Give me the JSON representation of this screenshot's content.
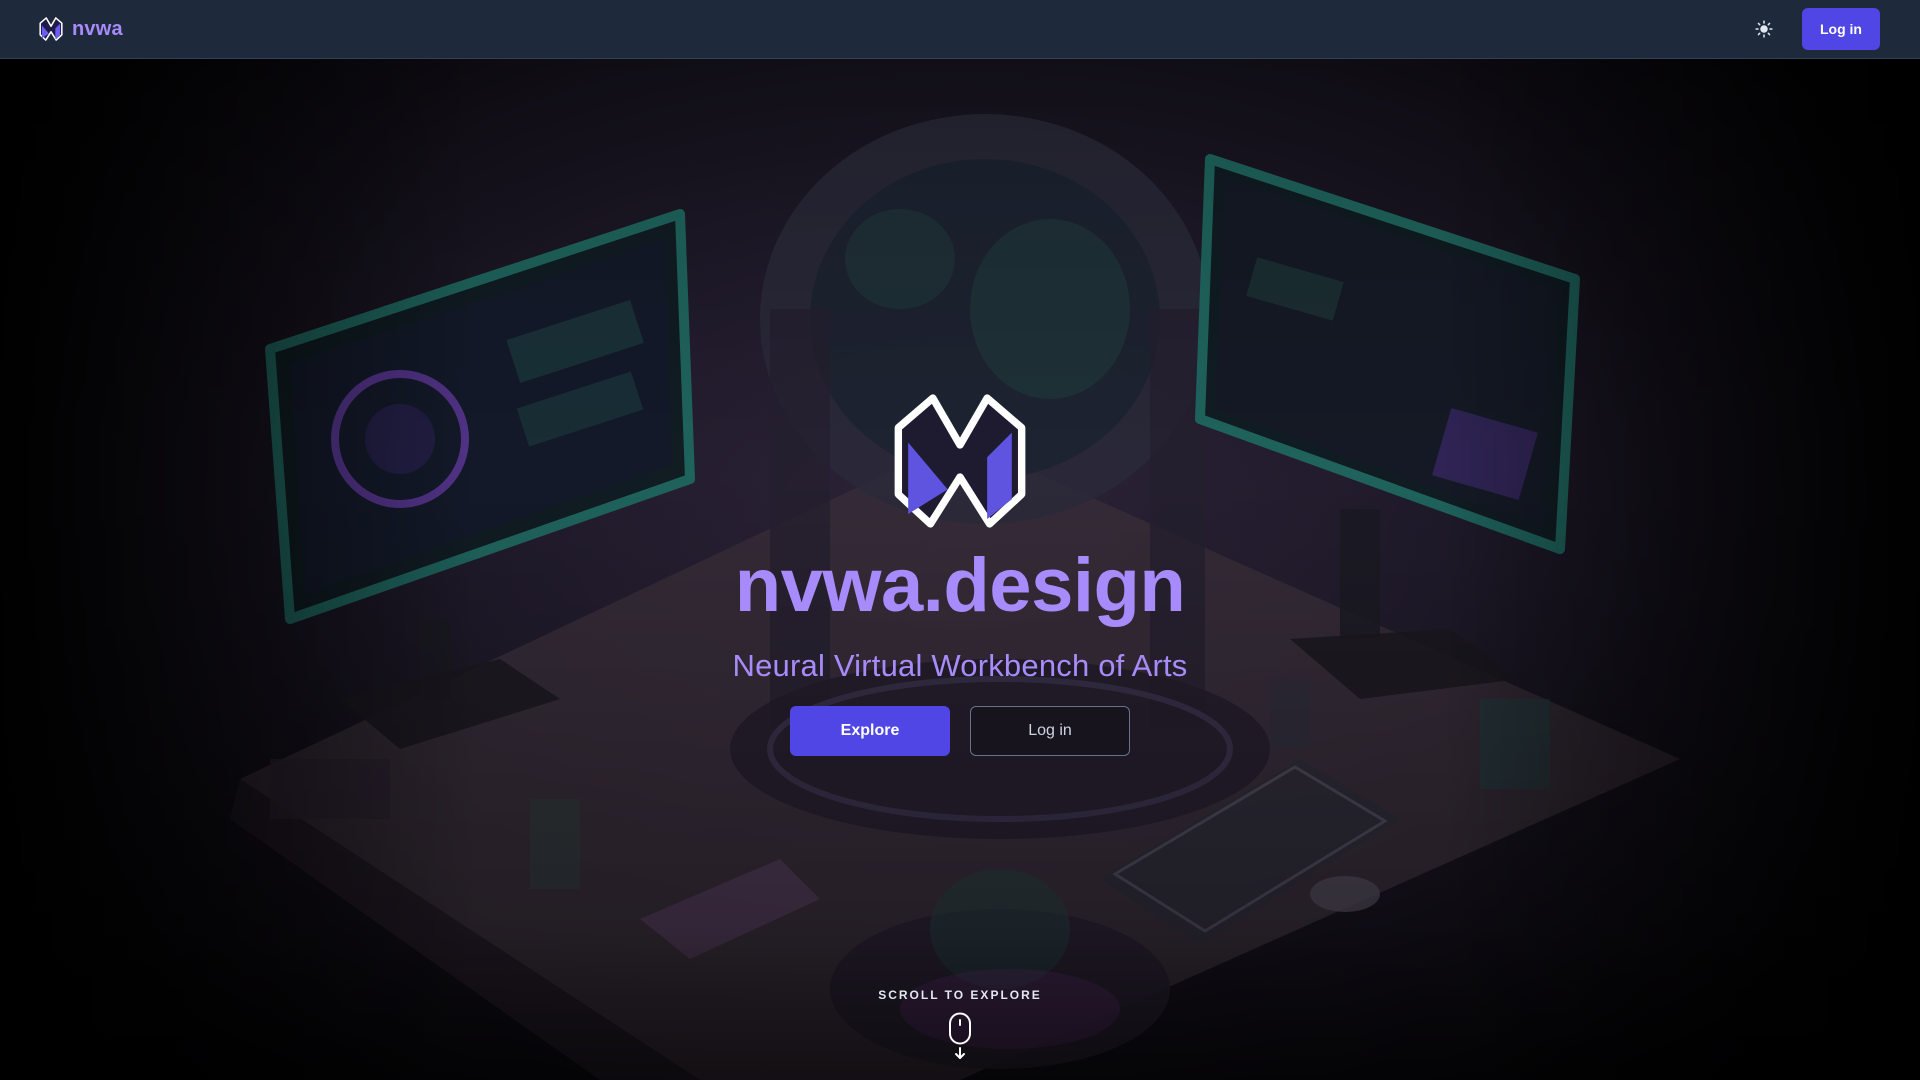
{
  "header": {
    "brand_name": "nvwa",
    "logo_icon": "nvwa-logo-icon",
    "theme_icon": "sun-icon",
    "login_label": "Log in"
  },
  "hero": {
    "logo_icon": "nvwa-logo-icon",
    "title": "nvwa.design",
    "subtitle": "Neural Virtual Workbench of Arts",
    "explore_label": "Explore",
    "login_label": "Log in",
    "scroll_label": "SCROLL TO EXPLORE",
    "scroll_icon": "mouse-scroll-icon"
  },
  "colors": {
    "accent": "#4f46e5",
    "brand_text": "#a78bfa",
    "navbar_bg": "#1e293b"
  }
}
